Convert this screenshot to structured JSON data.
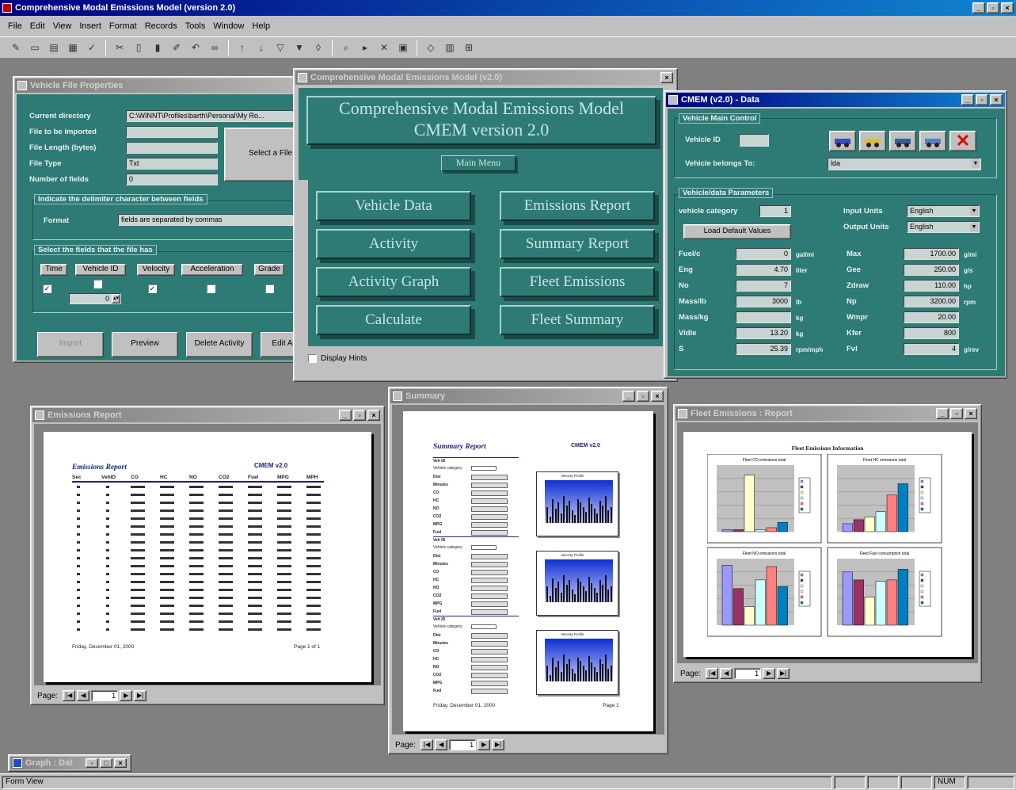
{
  "app": {
    "title": "Comprehensive Modal Emissions Model (version 2.0)",
    "controls": [
      "_",
      "▫",
      "×"
    ]
  },
  "menu": [
    "File",
    "Edit",
    "View",
    "Insert",
    "Format",
    "Records",
    "Tools",
    "Window",
    "Help"
  ],
  "toolbar": [
    {
      "icon": "design-view-icon",
      "g": "✎"
    },
    {
      "icon": "save-icon",
      "g": "▭"
    },
    {
      "icon": "print-icon",
      "g": "▤"
    },
    {
      "icon": "print-preview-icon",
      "g": "▦"
    },
    {
      "icon": "spelling-icon",
      "g": "✓"
    },
    {
      "icon": "cut-icon",
      "g": "✂"
    },
    {
      "icon": "copy-icon",
      "g": "▯"
    },
    {
      "icon": "paste-icon",
      "g": "▮"
    },
    {
      "icon": "format-painter-icon",
      "g": "✐"
    },
    {
      "icon": "undo-icon",
      "g": "↶"
    },
    {
      "icon": "hyperlink-icon",
      "g": "∞"
    },
    {
      "icon": "sort-asc-icon",
      "g": "↑"
    },
    {
      "icon": "sort-desc-icon",
      "g": "↓"
    },
    {
      "icon": "filter-selection-icon",
      "g": "▽"
    },
    {
      "icon": "filter-form-icon",
      "g": "▼"
    },
    {
      "icon": "apply-filter-icon",
      "g": "◊"
    },
    {
      "icon": "find-icon",
      "g": "⌕"
    },
    {
      "icon": "new-record-icon",
      "g": "▸"
    },
    {
      "icon": "delete-record-icon",
      "g": "✕"
    },
    {
      "icon": "properties-icon",
      "g": "▣"
    },
    {
      "icon": "build-icon",
      "g": "◇"
    },
    {
      "icon": "database-window-icon",
      "g": "▥"
    },
    {
      "icon": "new-object-icon",
      "g": "⊞"
    }
  ],
  "vehicle_file": {
    "title": "Vehicle File Properties",
    "labels": [
      "Current directory",
      "File to be imported",
      "File Length (bytes)",
      "File Type",
      "Number of fields"
    ],
    "values": [
      "C:\\WINNT\\Profiles\\barth\\Personal\\My Ro...",
      "",
      "",
      "Txt",
      "0"
    ],
    "select_label": "Select a File",
    "delim_header": "Indicate the delimiter character between fields",
    "format_label": "Format",
    "format_value": "fields are separated by commas",
    "fields_header": "Select the fields that the file has",
    "fields": [
      "Time",
      "Vehicle ID",
      "Velocity",
      "Acceleration",
      "Grade"
    ],
    "stepper": "0",
    "buttons": [
      "Import",
      "Preview",
      "Delete Activity",
      "Edit Ac"
    ]
  },
  "main": {
    "title": "Comprehensive Modal Emissions Model (v2.0)",
    "banner1": "Comprehensive Modal Emissions Model",
    "banner2": "CMEM    version 2.0",
    "main_menu": "Main Menu",
    "buttons": [
      "Vehicle Data",
      "Emissions Report",
      "Activity",
      "Summary Report",
      "Activity Graph",
      "Fleet Emissions",
      "Calculate",
      "Fleet Summary"
    ],
    "display_hints": "Display Hints"
  },
  "data": {
    "title": "CMEM (v2.0) - Data",
    "vehicle_header": "Vehicle Main Control",
    "vehicle_id_label": "Vehicle ID",
    "vehicle_id": "",
    "vehicle_belongs_label": "Vehicle belongs To:",
    "vehicle_belongs": "lda",
    "icons": [
      "vehicle-refresh-icon",
      "vehicle-add-icon",
      "vehicle-next-icon",
      "vehicle-copy-icon",
      "vehicle-delete-icon"
    ],
    "params_header": "Vehicle/data Parameters",
    "category_label": "vehicle category",
    "category_value": "1",
    "input_units_label": "Input Units",
    "input_units": "English",
    "output_units_label": "Output Units",
    "output_units": "English",
    "load_defaults": "Load Default Values",
    "left_params": [
      {
        "label": "Fuel/c",
        "value": "0",
        "unit": "gal/mi"
      },
      {
        "label": "Eng",
        "value": "4.70",
        "unit": "liter"
      },
      {
        "label": "No",
        "value": "7",
        "unit": ""
      },
      {
        "label": "Mass/lb",
        "value": "3000",
        "unit": "lb"
      },
      {
        "label": "Mass/kg",
        "value": "",
        "unit": "kg"
      },
      {
        "label": "Vidle",
        "value": "13.20",
        "unit": "kg"
      },
      {
        "label": "S",
        "value": "25.39",
        "unit": "rpm/mph"
      }
    ],
    "right_params": [
      {
        "label": "Max",
        "value": "1700.00",
        "unit": "g/mi"
      },
      {
        "label": "Gee",
        "value": "250.00",
        "unit": "g/s"
      },
      {
        "label": "Zdraw",
        "value": "110.00",
        "unit": "hp"
      },
      {
        "label": "Np",
        "value": "3200.00",
        "unit": "rpm"
      },
      {
        "label": "Wmpr",
        "value": "20.00",
        "unit": ""
      },
      {
        "label": "Kfer",
        "value": "800",
        "unit": ""
      },
      {
        "label": "Fvl",
        "value": "4",
        "unit": "g/rev"
      }
    ]
  },
  "emissions_report": {
    "title": "Emissions Report",
    "heading": "Emissions Report",
    "model": "CMEM v2.0",
    "columns": [
      "Sec",
      "VehID",
      "CO",
      "HC",
      "NO",
      "CO2",
      "Fuel",
      "MPG",
      "MPH"
    ],
    "footer_left": "Friday, December 01, 2000",
    "footer_right": "Page 1 of 1",
    "page": "1"
  },
  "summary_report": {
    "title": "Summary",
    "heading": "Summary Report",
    "model": "CMEM v2.0",
    "sections": [
      {
        "label": "Veh ID",
        "class": "Vehicle category",
        "rows": [
          "Dist",
          "Minutes",
          "CO",
          "HC",
          "NO",
          "CO2",
          "MPG",
          "Fuel"
        ]
      },
      {
        "label": "Veh ID",
        "class": "Vehicle category",
        "rows": [
          "Dist",
          "Minutes",
          "CO",
          "HC",
          "NO",
          "CO2",
          "MPG",
          "Fuel"
        ]
      },
      {
        "label": "Veh ID",
        "class": "Vehicle category",
        "rows": [
          "Dist",
          "Minutes",
          "CO",
          "HC",
          "NO",
          "CO2",
          "MPG",
          "Fuel"
        ]
      }
    ],
    "chart_title": "Velocity Profile",
    "footer_left": "Friday, December 01, 2000",
    "footer_right": "Page 1",
    "page": "1"
  },
  "fleet_report": {
    "title": "Fleet Emissions : Report",
    "heading": "Fleet Emissions Information",
    "chart_titles": [
      "Fleet CO emissions total",
      "Fleet HC emissions total",
      "Fleet NO emissions total",
      "Fleet Fuel consumption total"
    ],
    "page": "1"
  },
  "minimized": {
    "title": "Graph : Dat",
    "controls": [
      "▫",
      "□",
      "×"
    ]
  },
  "status": {
    "left": "Form View",
    "num": "NUM"
  },
  "chart_data": [
    {
      "type": "bar",
      "title": "Fleet CO emissions total",
      "categories": [
        "1",
        "2",
        "3",
        "4",
        "5",
        "6"
      ],
      "values": [
        3,
        3,
        85,
        3,
        6,
        14
      ],
      "ylim": [
        0,
        100
      ],
      "colors": [
        "#9999ff",
        "#993366",
        "#ffffcc",
        "#ccffff",
        "#ff8080",
        "#0080c0"
      ]
    },
    {
      "type": "bar",
      "title": "Fleet HC emissions total",
      "categories": [
        "1",
        "2",
        "3",
        "4",
        "5",
        "6"
      ],
      "values": [
        12,
        18,
        22,
        30,
        55,
        72
      ],
      "ylim": [
        0,
        100
      ],
      "colors": [
        "#9999ff",
        "#993366",
        "#ffffcc",
        "#ccffff",
        "#ff8080",
        "#0080c0"
      ]
    },
    {
      "type": "bar",
      "title": "Fleet NO emissions total",
      "categories": [
        "1",
        "2",
        "3",
        "4",
        "5",
        "6"
      ],
      "values": [
        90,
        55,
        28,
        68,
        88,
        58
      ],
      "ylim": [
        0,
        100
      ],
      "colors": [
        "#9999ff",
        "#993366",
        "#ffffcc",
        "#ccffff",
        "#ff8080",
        "#0080c0"
      ]
    },
    {
      "type": "bar",
      "title": "Fleet Fuel consumption total",
      "categories": [
        "1",
        "2",
        "3",
        "4",
        "5",
        "6"
      ],
      "values": [
        80,
        68,
        42,
        66,
        68,
        84
      ],
      "ylim": [
        0,
        100
      ],
      "colors": [
        "#9999ff",
        "#993366",
        "#ffffcc",
        "#ccffff",
        "#ff8080",
        "#0080c0"
      ]
    }
  ]
}
